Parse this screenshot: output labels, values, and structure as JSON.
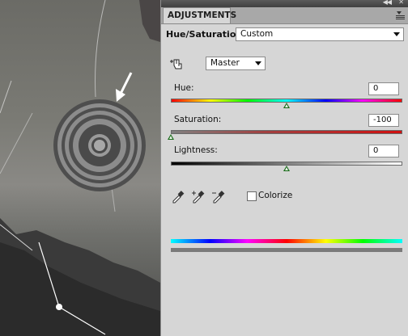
{
  "panel": {
    "tab_label": "ADJUSTMENTS",
    "adjustment_title": "Hue/Saturation",
    "preset": "Custom",
    "channel": "Master",
    "hue": {
      "label": "Hue:",
      "value": "0",
      "fraction": 0.5
    },
    "saturation": {
      "label": "Saturation:",
      "value": "-100",
      "fraction": 0.0
    },
    "lightness": {
      "label": "Lightness:",
      "value": "0",
      "fraction": 0.5
    },
    "colorize": {
      "label": "Colorize",
      "checked": false
    },
    "icons": [
      "collapse-icon",
      "close-icon",
      "panel-menu-icon",
      "target-adjust-icon",
      "eyedropper-icon",
      "eyedropper-plus-icon",
      "eyedropper-minus-icon"
    ]
  },
  "colors": {
    "panel_bg": "#d6d6d6",
    "slider_thumb": "#1a6b1a",
    "saturation_track": "#d01010"
  }
}
